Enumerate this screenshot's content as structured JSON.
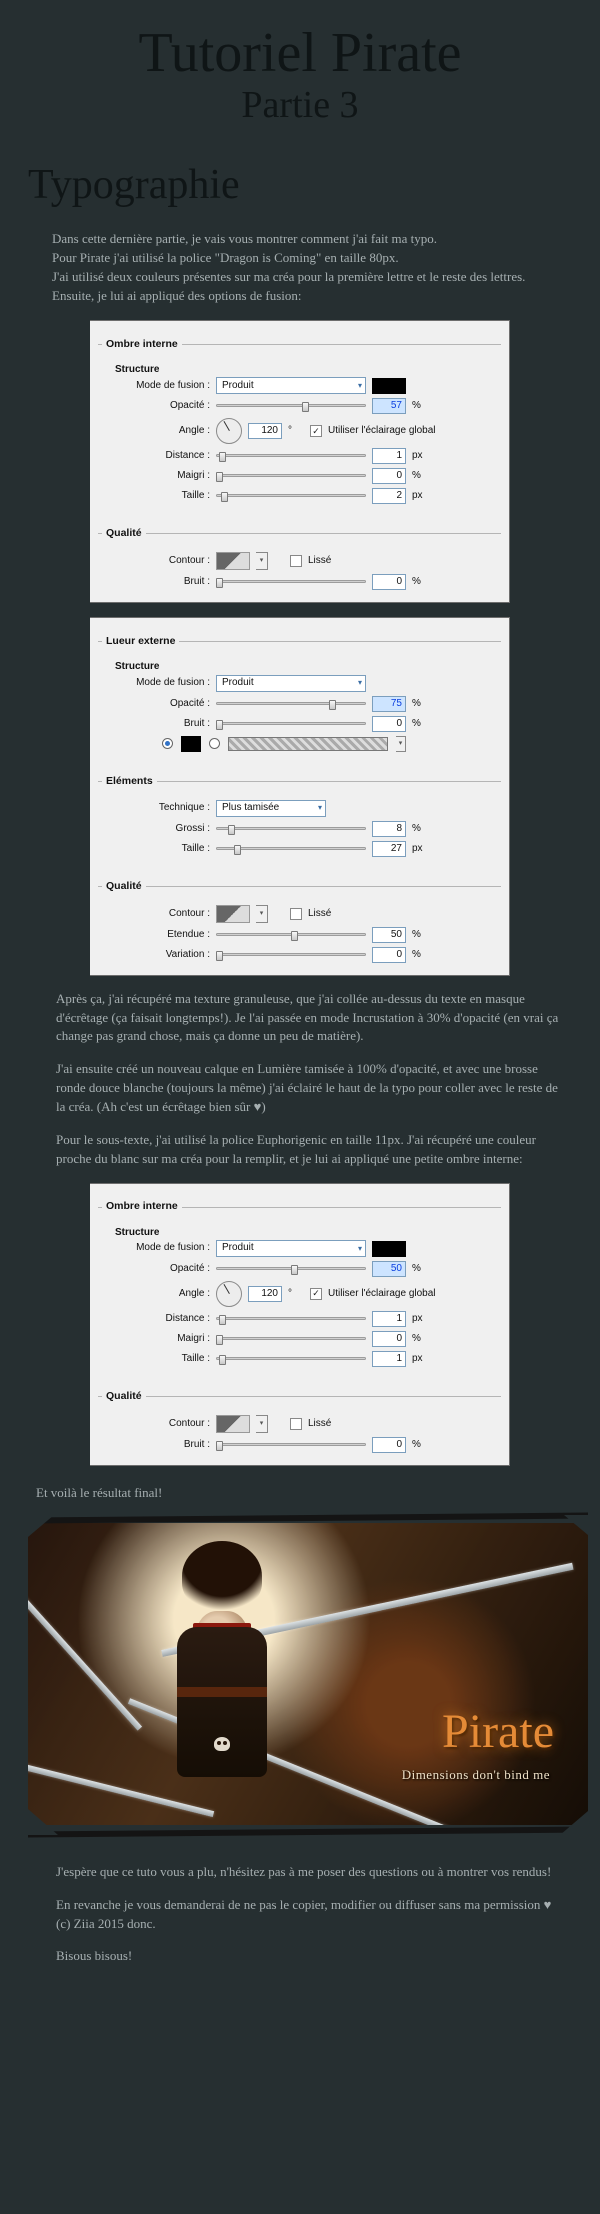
{
  "header": {
    "title": "Tutoriel Pirate",
    "subtitle": "Partie 3"
  },
  "section": {
    "title": "Typographie"
  },
  "intro": {
    "p1": "Dans cette dernière partie, je vais vous montrer comment j'ai fait ma typo.",
    "p2": "Pour Pirate j'ai utilisé la police \"Dragon is Coming\" en taille 80px.",
    "p3": "J'ai utilisé deux couleurs présentes sur ma créa pour la première lettre et le reste des lettres.",
    "p4": "Ensuite, je lui ai appliqué des options de fusion:"
  },
  "labels": {
    "ombre_interne": "Ombre interne",
    "lueur_externe": "Lueur externe",
    "structure": "Structure",
    "qualite": "Qualité",
    "elements": "Eléments",
    "mode_fusion": "Mode de fusion :",
    "opacite": "Opacité :",
    "angle": "Angle :",
    "distance": "Distance :",
    "maigri": "Maigri :",
    "taille": "Taille :",
    "contour": "Contour :",
    "lisse": "Lissé",
    "bruit": "Bruit :",
    "technique": "Technique :",
    "grossi": "Grossi :",
    "etendue": "Etendue :",
    "variation": "Variation :",
    "eclairage_global": "Utiliser l'éclairage global",
    "produit": "Produit",
    "plus_tamisee": "Plus tamisée",
    "px": "px",
    "pct": "%",
    "deg": "°"
  },
  "panel1": {
    "blend": "Produit",
    "opacite": "57",
    "angle": "120",
    "global": true,
    "distance": "1",
    "maigri": "0",
    "taille": "2",
    "lisse": false,
    "bruit": "0",
    "sliders": {
      "opacite": 57,
      "distance": 2,
      "maigri": 0,
      "taille": 3,
      "bruit": 0
    }
  },
  "panel2": {
    "blend": "Produit",
    "opacite": "75",
    "bruit": "0",
    "technique": "Plus tamisée",
    "grossi": "8",
    "taille": "27",
    "lisse": false,
    "etendue": "50",
    "variation": "0",
    "sliders": {
      "opacite": 75,
      "bruit": 0,
      "grossi": 8,
      "taille": 12,
      "etendue": 50,
      "variation": 0
    }
  },
  "mid": {
    "p1": "Après ça, j'ai récupéré ma texture granuleuse, que j'ai collée au-dessus du texte en masque d'écrêtage (ça faisait longtemps!). Je l'ai passée en mode Incrustation à 30% d'opacité (en vrai ça change pas grand chose, mais ça donne un peu de matière).",
    "p2": "J'ai ensuite créé un nouveau calque en Lumière tamisée à 100% d'opacité, et avec une brosse ronde douce blanche (toujours la même) j'ai éclairé le haut de la typo pour coller avec le reste de la créa. (Ah c'est un écrêtage bien sûr ♥)",
    "p3": "Pour le sous-texte, j'ai utilisé la police Euphorigenic en taille 11px. J'ai récupéré une couleur proche du blanc sur ma créa pour la remplir, et je lui ai appliqué une petite ombre interne:"
  },
  "panel3": {
    "blend": "Produit",
    "opacite": "50",
    "angle": "120",
    "global": true,
    "distance": "1",
    "maigri": "0",
    "taille": "1",
    "lisse": false,
    "bruit": "0",
    "sliders": {
      "opacite": 50,
      "distance": 2,
      "maigri": 0,
      "taille": 2,
      "bruit": 0
    }
  },
  "result_line": "Et voilà le résultat final!",
  "artwork": {
    "title": "Pirate",
    "subtitle": "Dimensions don't bind me"
  },
  "outro": {
    "p1": "J'espère que ce tuto vous a plu, n'hésitez pas à me poser des questions ou à montrer vos rendus!",
    "p2": "En revanche je vous demanderai de ne pas le copier, modifier ou diffuser sans ma permission ♥ (c) Ziia 2015 donc.",
    "p3": "Bisous bisous!"
  }
}
